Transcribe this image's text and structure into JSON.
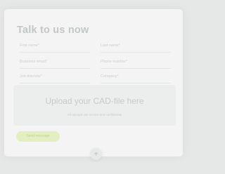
{
  "form": {
    "title": "Talk to us now",
    "fields": [
      {
        "name": "first-name",
        "placeholder": "First name*"
      },
      {
        "name": "last-name",
        "placeholder": "Last name*"
      },
      {
        "name": "business-email",
        "placeholder": "Business email*"
      },
      {
        "name": "phone-number",
        "placeholder": "Phone number*"
      },
      {
        "name": "job-title",
        "placeholder": "Job title/role*"
      },
      {
        "name": "company",
        "placeholder": "Company*"
      }
    ],
    "upload": {
      "title": "Upload your CAD-file here",
      "subtitle": "All uploads are secure and confidential"
    },
    "send_label": "Send message"
  },
  "scroll_button": {
    "icon": "arrow-up-icon"
  },
  "colors": {
    "background": "#e6e8e7",
    "card": "#f3f4f3",
    "accent": "#e3efc0"
  }
}
